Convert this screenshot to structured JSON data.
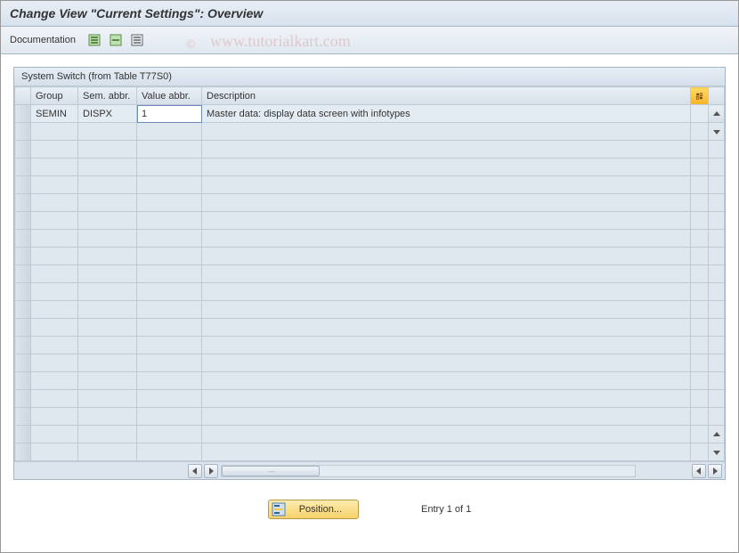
{
  "header": {
    "title": "Change View \"Current Settings\": Overview"
  },
  "toolbar": {
    "documentation_label": "Documentation"
  },
  "table": {
    "caption": "System Switch (from Table T77S0)",
    "columns": {
      "group": "Group",
      "sem_abbr": "Sem. abbr.",
      "value_abbr": "Value abbr.",
      "description": "Description"
    },
    "rows": [
      {
        "group": "SEMIN",
        "sem_abbr": "DISPX",
        "value_abbr": "1",
        "description": "Master data: display data screen with infotypes"
      }
    ],
    "empty_row_count": 19
  },
  "footer": {
    "position_label": "Position...",
    "status_text": "Entry 1 of 1"
  },
  "watermark": {
    "symbol": "©",
    "text": "www.tutorialkart.com"
  }
}
